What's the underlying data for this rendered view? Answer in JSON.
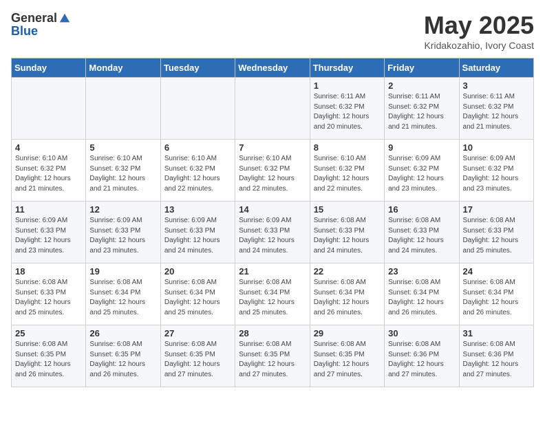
{
  "header": {
    "logo_general": "General",
    "logo_blue": "Blue",
    "month_title": "May 2025",
    "location": "Kridakozahio, Ivory Coast"
  },
  "weekdays": [
    "Sunday",
    "Monday",
    "Tuesday",
    "Wednesday",
    "Thursday",
    "Friday",
    "Saturday"
  ],
  "weeks": [
    [
      {
        "day": "",
        "info": ""
      },
      {
        "day": "",
        "info": ""
      },
      {
        "day": "",
        "info": ""
      },
      {
        "day": "",
        "info": ""
      },
      {
        "day": "1",
        "info": "Sunrise: 6:11 AM\nSunset: 6:32 PM\nDaylight: 12 hours\nand 20 minutes."
      },
      {
        "day": "2",
        "info": "Sunrise: 6:11 AM\nSunset: 6:32 PM\nDaylight: 12 hours\nand 21 minutes."
      },
      {
        "day": "3",
        "info": "Sunrise: 6:11 AM\nSunset: 6:32 PM\nDaylight: 12 hours\nand 21 minutes."
      }
    ],
    [
      {
        "day": "4",
        "info": "Sunrise: 6:10 AM\nSunset: 6:32 PM\nDaylight: 12 hours\nand 21 minutes."
      },
      {
        "day": "5",
        "info": "Sunrise: 6:10 AM\nSunset: 6:32 PM\nDaylight: 12 hours\nand 21 minutes."
      },
      {
        "day": "6",
        "info": "Sunrise: 6:10 AM\nSunset: 6:32 PM\nDaylight: 12 hours\nand 22 minutes."
      },
      {
        "day": "7",
        "info": "Sunrise: 6:10 AM\nSunset: 6:32 PM\nDaylight: 12 hours\nand 22 minutes."
      },
      {
        "day": "8",
        "info": "Sunrise: 6:10 AM\nSunset: 6:32 PM\nDaylight: 12 hours\nand 22 minutes."
      },
      {
        "day": "9",
        "info": "Sunrise: 6:09 AM\nSunset: 6:32 PM\nDaylight: 12 hours\nand 23 minutes."
      },
      {
        "day": "10",
        "info": "Sunrise: 6:09 AM\nSunset: 6:32 PM\nDaylight: 12 hours\nand 23 minutes."
      }
    ],
    [
      {
        "day": "11",
        "info": "Sunrise: 6:09 AM\nSunset: 6:33 PM\nDaylight: 12 hours\nand 23 minutes."
      },
      {
        "day": "12",
        "info": "Sunrise: 6:09 AM\nSunset: 6:33 PM\nDaylight: 12 hours\nand 23 minutes."
      },
      {
        "day": "13",
        "info": "Sunrise: 6:09 AM\nSunset: 6:33 PM\nDaylight: 12 hours\nand 24 minutes."
      },
      {
        "day": "14",
        "info": "Sunrise: 6:09 AM\nSunset: 6:33 PM\nDaylight: 12 hours\nand 24 minutes."
      },
      {
        "day": "15",
        "info": "Sunrise: 6:08 AM\nSunset: 6:33 PM\nDaylight: 12 hours\nand 24 minutes."
      },
      {
        "day": "16",
        "info": "Sunrise: 6:08 AM\nSunset: 6:33 PM\nDaylight: 12 hours\nand 24 minutes."
      },
      {
        "day": "17",
        "info": "Sunrise: 6:08 AM\nSunset: 6:33 PM\nDaylight: 12 hours\nand 25 minutes."
      }
    ],
    [
      {
        "day": "18",
        "info": "Sunrise: 6:08 AM\nSunset: 6:33 PM\nDaylight: 12 hours\nand 25 minutes."
      },
      {
        "day": "19",
        "info": "Sunrise: 6:08 AM\nSunset: 6:34 PM\nDaylight: 12 hours\nand 25 minutes."
      },
      {
        "day": "20",
        "info": "Sunrise: 6:08 AM\nSunset: 6:34 PM\nDaylight: 12 hours\nand 25 minutes."
      },
      {
        "day": "21",
        "info": "Sunrise: 6:08 AM\nSunset: 6:34 PM\nDaylight: 12 hours\nand 25 minutes."
      },
      {
        "day": "22",
        "info": "Sunrise: 6:08 AM\nSunset: 6:34 PM\nDaylight: 12 hours\nand 26 minutes."
      },
      {
        "day": "23",
        "info": "Sunrise: 6:08 AM\nSunset: 6:34 PM\nDaylight: 12 hours\nand 26 minutes."
      },
      {
        "day": "24",
        "info": "Sunrise: 6:08 AM\nSunset: 6:34 PM\nDaylight: 12 hours\nand 26 minutes."
      }
    ],
    [
      {
        "day": "25",
        "info": "Sunrise: 6:08 AM\nSunset: 6:35 PM\nDaylight: 12 hours\nand 26 minutes."
      },
      {
        "day": "26",
        "info": "Sunrise: 6:08 AM\nSunset: 6:35 PM\nDaylight: 12 hours\nand 26 minutes."
      },
      {
        "day": "27",
        "info": "Sunrise: 6:08 AM\nSunset: 6:35 PM\nDaylight: 12 hours\nand 27 minutes."
      },
      {
        "day": "28",
        "info": "Sunrise: 6:08 AM\nSunset: 6:35 PM\nDaylight: 12 hours\nand 27 minutes."
      },
      {
        "day": "29",
        "info": "Sunrise: 6:08 AM\nSunset: 6:35 PM\nDaylight: 12 hours\nand 27 minutes."
      },
      {
        "day": "30",
        "info": "Sunrise: 6:08 AM\nSunset: 6:36 PM\nDaylight: 12 hours\nand 27 minutes."
      },
      {
        "day": "31",
        "info": "Sunrise: 6:08 AM\nSunset: 6:36 PM\nDaylight: 12 hours\nand 27 minutes."
      }
    ]
  ]
}
